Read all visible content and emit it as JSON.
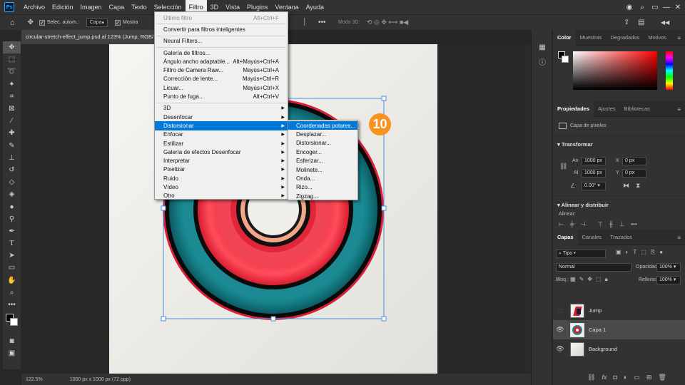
{
  "menubar": {
    "logo": "Ps",
    "items": [
      "Archivo",
      "Edición",
      "Imagen",
      "Capa",
      "Texto",
      "Selección",
      "Filtro",
      "3D",
      "Vista",
      "Plugins",
      "Ventana",
      "Ayuda"
    ],
    "active_index": 6
  },
  "options": {
    "auto_select_label": "Selec. autom.:",
    "auto_select_value": "Capa",
    "show_label": "Mostra",
    "mode_3d": "Modo 3D:"
  },
  "document": {
    "tab_title": "circular-stretch-effect_jump.psd al 123% (Jump, RGB/..."
  },
  "status": {
    "zoom": "122.5%",
    "size": "1000 px x 1000 px (72 ppp)"
  },
  "filter_menu": {
    "items": [
      {
        "label": "Último filtro",
        "shortcut": "Alt+Ctrl+F",
        "disabled": true
      },
      {
        "sep": true
      },
      {
        "label": "Convertir para filtros inteligentes"
      },
      {
        "sep": true
      },
      {
        "label": "Neural Filters..."
      },
      {
        "sep": true
      },
      {
        "label": "Galería de filtros..."
      },
      {
        "label": "Ángulo ancho adaptable...",
        "shortcut": "Alt+Mayús+Ctrl+A"
      },
      {
        "label": "Filtro de Camera Raw...",
        "shortcut": "Mayús+Ctrl+A"
      },
      {
        "label": "Corrección de lente...",
        "shortcut": "Mayús+Ctrl+R"
      },
      {
        "label": "Licuar...",
        "shortcut": "Mayús+Ctrl+X"
      },
      {
        "label": "Punto de fuga...",
        "shortcut": "Alt+Ctrl+V"
      },
      {
        "sep": true
      },
      {
        "label": "3D",
        "sub": true
      },
      {
        "label": "Desenfocar",
        "sub": true
      },
      {
        "label": "Distorsionar",
        "sub": true,
        "highlight": true
      },
      {
        "label": "Enfocar",
        "sub": true
      },
      {
        "label": "Estilizar",
        "sub": true
      },
      {
        "label": "Galería de efectos Desenfocar",
        "sub": true
      },
      {
        "label": "Interpretar",
        "sub": true
      },
      {
        "label": "Pixelizar",
        "sub": true
      },
      {
        "label": "Ruido",
        "sub": true
      },
      {
        "label": "Vídeo",
        "sub": true
      },
      {
        "label": "Otro",
        "sub": true
      }
    ]
  },
  "distort_submenu": {
    "items": [
      "Coordenadas polares...",
      "Desplazar...",
      "Distorsionar...",
      "Encoger...",
      "Esferizar...",
      "Molinete...",
      "Onda...",
      "Rizo...",
      "Zigzag..."
    ],
    "highlight_index": 0
  },
  "step_badge": "10",
  "color_panel": {
    "tabs": [
      "Color",
      "Muestras",
      "Degradados",
      "Motivos"
    ],
    "accent": "#ff0000"
  },
  "properties_panel": {
    "tabs": [
      "Propiedades",
      "Ajustes",
      "Bibliotecas"
    ],
    "layer_kind": "Capa de píxeles",
    "transform_title": "Transformar",
    "w_label": "An",
    "w_value": "1000 px",
    "h_label": "Al",
    "h_value": "1000 px",
    "x_label": "X",
    "x_value": "0 px",
    "y_label": "Y",
    "y_value": "0 px",
    "angle_value": "0.00°",
    "align_title": "Alinear y distribuir",
    "align_label": "Alinear:"
  },
  "layers_panel": {
    "tabs": [
      "Capas",
      "Canales",
      "Trazados"
    ],
    "filter_kind": "Tipo",
    "blend_mode": "Normal",
    "opacity_label": "Opacidad:",
    "opacity_value": "100%",
    "lock_label": "Bloq.:",
    "fill_label": "Relleno:",
    "fill_value": "100%",
    "layers": [
      {
        "name": "Jump",
        "visible": false,
        "selected": false
      },
      {
        "name": "Capa 1",
        "visible": true,
        "selected": true
      },
      {
        "name": "Background",
        "visible": true,
        "selected": false
      }
    ]
  }
}
